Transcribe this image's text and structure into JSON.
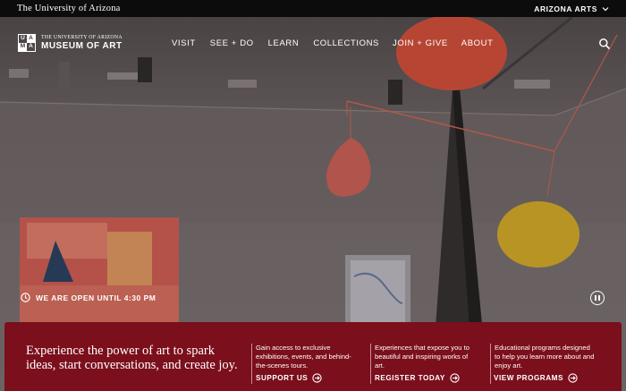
{
  "topbar": {
    "university": "The University of Arizona",
    "arts_menu": "ARIZONA ARTS"
  },
  "logo": {
    "mark_letters": [
      "U",
      "A",
      "M",
      "A"
    ],
    "line1": "THE UNIVERSITY OF ARIZONA",
    "line2": "MUSEUM OF ART"
  },
  "nav": {
    "items": [
      "VISIT",
      "SEE + DO",
      "LEARN",
      "COLLECTIONS",
      "JOIN + GIVE",
      "ABOUT"
    ]
  },
  "hero": {
    "open_status": "WE ARE OPEN UNTIL 4:30 PM"
  },
  "panel": {
    "headline": "Experience the power of art to spark ideas, start conversations, and create joy.",
    "columns": [
      {
        "desc": "Gain access to exclusive exhibitions, events, and behind-the-scenes tours.",
        "cta": "SUPPORT US"
      },
      {
        "desc": "Experiences that expose you to beautiful and inspiring works of art.",
        "cta": "REGISTER TODAY"
      },
      {
        "desc": "Educational programs designed to help you learn more about and enjoy art.",
        "cta": "VIEW PROGRAMS"
      }
    ]
  },
  "colors": {
    "panel_red": "#7b0f1c",
    "topbar": "#0c0c0c"
  }
}
